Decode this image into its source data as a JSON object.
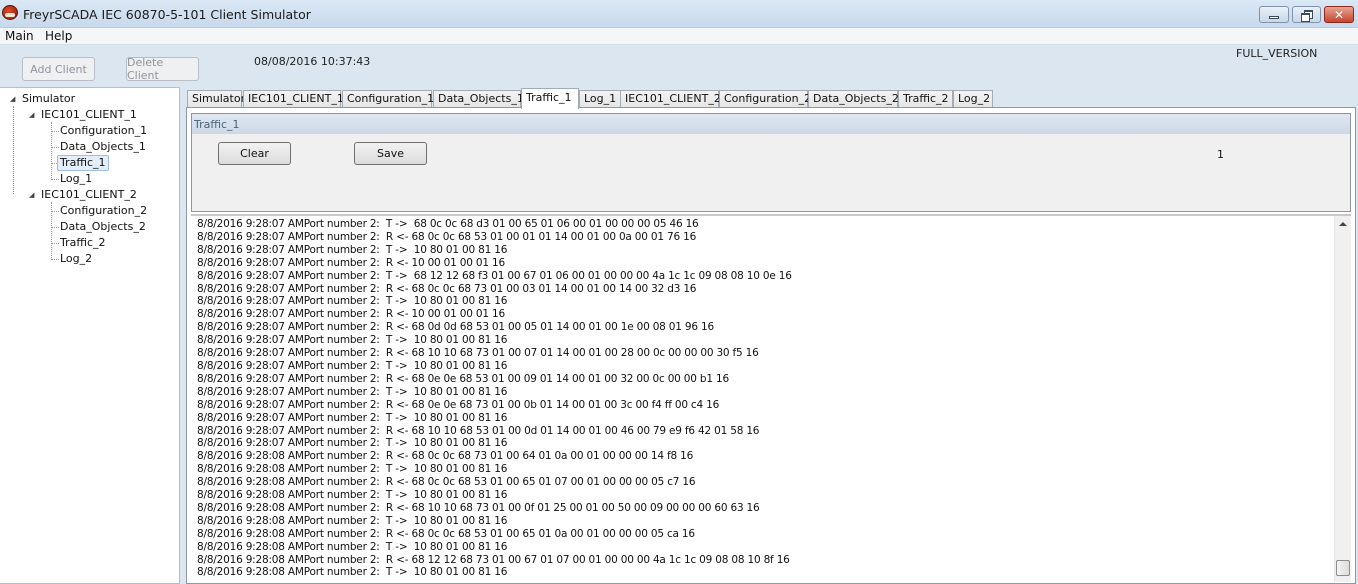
{
  "window": {
    "title": "FreyrSCADA IEC 60870-5-101 Client Simulator",
    "controls": {
      "minimize": "minimize",
      "restore": "restore",
      "close": "✕"
    }
  },
  "menu": {
    "items": [
      {
        "label": "Main"
      },
      {
        "label": "Help"
      }
    ]
  },
  "toolbar": {
    "add_client_label": "Add Client",
    "delete_client_label": "Delete Client",
    "datetime": "08/08/2016 10:37:43",
    "version": "FULL_VERSION"
  },
  "tree": {
    "root": "Simulator",
    "clients": [
      {
        "label": "IEC101_CLIENT_1",
        "children": [
          "Configuration_1",
          "Data_Objects_1",
          "Traffic_1",
          "Log_1"
        ]
      },
      {
        "label": "IEC101_CLIENT_2",
        "children": [
          "Configuration_2",
          "Data_Objects_2",
          "Traffic_2",
          "Log_2"
        ]
      }
    ],
    "selected": "Traffic_1"
  },
  "tabs": [
    {
      "label": "Simulator"
    },
    {
      "label": "IEC101_CLIENT_1"
    },
    {
      "label": "Configuration_1"
    },
    {
      "label": "Data_Objects_1"
    },
    {
      "label": "Traffic_1",
      "active": true
    },
    {
      "label": "Log_1"
    },
    {
      "label": "IEC101_CLIENT_2"
    },
    {
      "label": "Configuration_2"
    },
    {
      "label": "Data_Objects_2"
    },
    {
      "label": "Traffic_2"
    },
    {
      "label": "Log_2"
    }
  ],
  "traffic": {
    "group_title": "Traffic_1",
    "clear_label": "Clear",
    "save_label": "Save",
    "counter": "1",
    "lines": [
      "8/8/2016 9:28:07 AMPort number 2:  T ->  68 0c 0c 68 d3 01 00 65 01 06 00 01 00 00 00 05 46 16",
      "8/8/2016 9:28:07 AMPort number 2:  R <- 68 0c 0c 68 53 01 00 01 01 14 00 01 00 0a 00 01 76 16",
      "8/8/2016 9:28:07 AMPort number 2:  T ->  10 80 01 00 81 16",
      "8/8/2016 9:28:07 AMPort number 2:  R <- 10 00 01 00 01 16",
      "8/8/2016 9:28:07 AMPort number 2:  T ->  68 12 12 68 f3 01 00 67 01 06 00 01 00 00 00 4a 1c 1c 09 08 08 10 0e 16",
      "8/8/2016 9:28:07 AMPort number 2:  R <- 68 0c 0c 68 73 01 00 03 01 14 00 01 00 14 00 32 d3 16",
      "8/8/2016 9:28:07 AMPort number 2:  T ->  10 80 01 00 81 16",
      "8/8/2016 9:28:07 AMPort number 2:  R <- 10 00 01 00 01 16",
      "8/8/2016 9:28:07 AMPort number 2:  R <- 68 0d 0d 68 53 01 00 05 01 14 00 01 00 1e 00 08 01 96 16",
      "8/8/2016 9:28:07 AMPort number 2:  T ->  10 80 01 00 81 16",
      "8/8/2016 9:28:07 AMPort number 2:  R <- 68 10 10 68 73 01 00 07 01 14 00 01 00 28 00 0c 00 00 00 30 f5 16",
      "8/8/2016 9:28:07 AMPort number 2:  T ->  10 80 01 00 81 16",
      "8/8/2016 9:28:07 AMPort number 2:  R <- 68 0e 0e 68 53 01 00 09 01 14 00 01 00 32 00 0c 00 00 b1 16",
      "8/8/2016 9:28:07 AMPort number 2:  T ->  10 80 01 00 81 16",
      "8/8/2016 9:28:07 AMPort number 2:  R <- 68 0e 0e 68 73 01 00 0b 01 14 00 01 00 3c 00 f4 ff 00 c4 16",
      "8/8/2016 9:28:07 AMPort number 2:  T ->  10 80 01 00 81 16",
      "8/8/2016 9:28:07 AMPort number 2:  R <- 68 10 10 68 53 01 00 0d 01 14 00 01 00 46 00 79 e9 f6 42 01 58 16",
      "8/8/2016 9:28:07 AMPort number 2:  T ->  10 80 01 00 81 16",
      "8/8/2016 9:28:08 AMPort number 2:  R <- 68 0c 0c 68 73 01 00 64 01 0a 00 01 00 00 00 14 f8 16",
      "8/8/2016 9:28:08 AMPort number 2:  T ->  10 80 01 00 81 16",
      "8/8/2016 9:28:08 AMPort number 2:  R <- 68 0c 0c 68 53 01 00 65 01 07 00 01 00 00 00 05 c7 16",
      "8/8/2016 9:28:08 AMPort number 2:  T ->  10 80 01 00 81 16",
      "8/8/2016 9:28:08 AMPort number 2:  R <- 68 10 10 68 73 01 00 0f 01 25 00 01 00 50 00 09 00 00 00 60 63 16",
      "8/8/2016 9:28:08 AMPort number 2:  T ->  10 80 01 00 81 16",
      "8/8/2016 9:28:08 AMPort number 2:  R <- 68 0c 0c 68 53 01 00 65 01 0a 00 01 00 00 00 05 ca 16",
      "8/8/2016 9:28:08 AMPort number 2:  T ->  10 80 01 00 81 16",
      "8/8/2016 9:28:08 AMPort number 2:  R <- 68 12 12 68 73 01 00 67 01 07 00 01 00 00 00 4a 1c 1c 09 08 08 10 8f 16",
      "8/8/2016 9:28:08 AMPort number 2:  T ->  10 80 01 00 81 16"
    ]
  }
}
